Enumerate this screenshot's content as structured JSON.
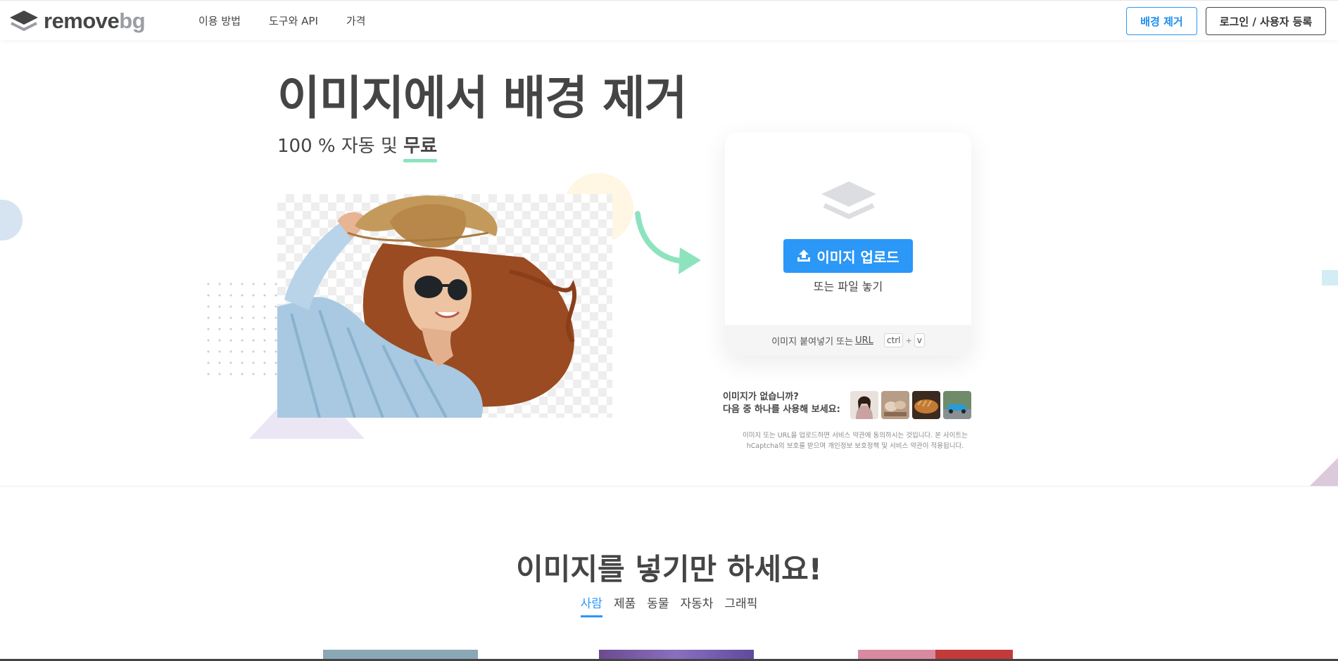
{
  "nav": {
    "logo_main": "remove",
    "logo_accent": "bg",
    "links": [
      "이용 방법",
      "도구와 API",
      "가격"
    ],
    "remove_bg_button": "배경 제거",
    "login_button": "로그인 / 사용자 등록"
  },
  "hero": {
    "title": "이미지에서 배경 제거",
    "subtitle_prefix": "100 % 자동 및 ",
    "subtitle_highlight": "무료"
  },
  "upload": {
    "button_label": "이미지 업로드",
    "drop_text": "또는 파일 놓기",
    "paste_text": "이미지 붙여넣기 또는",
    "url_link": "URL",
    "key_ctrl": "ctrl",
    "key_plus": "+",
    "key_v": "v"
  },
  "samples": {
    "line1": "이미지가 없습니까?",
    "line2": "다음 중 하나를 사용해 보세요:"
  },
  "legal": {
    "line1": "이미지 또는 URL을 업로드하면 서비스 약관에 동의하시는 것입니다. 본 사이트는",
    "line2": "hCaptcha의 보호를 받으며 개인정보 보호정책 및 서비스 약관이 적용됩니다."
  },
  "section2": {
    "title": "이미지를 넣기만 하세요!",
    "tabs": [
      "사람",
      "제품",
      "동물",
      "자동차",
      "그래픽"
    ]
  },
  "colors": {
    "accent_blue": "#2b97f7",
    "highlight_green": "#8ee3bf",
    "text_dark": "#454545"
  },
  "icons": {
    "logo": "layers-logo-icon",
    "upload": "upload-icon",
    "card": "layers-icon",
    "arrow": "curved-arrow-icon"
  }
}
